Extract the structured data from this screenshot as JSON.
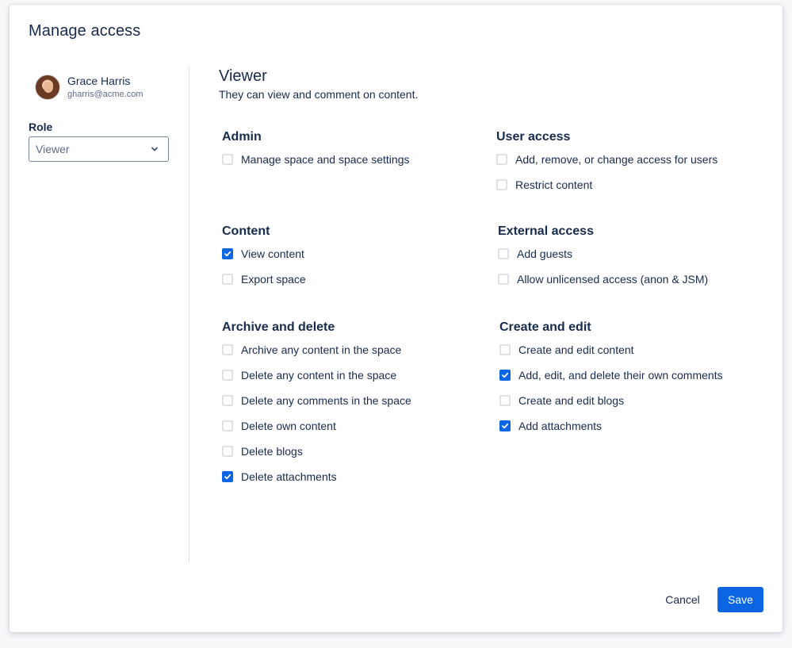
{
  "dialog": {
    "title": "Manage access"
  },
  "user": {
    "name": "Grace Harris",
    "email": "gharris@acme.com",
    "avatar_icon": "user-avatar-photo"
  },
  "role": {
    "label": "Role",
    "selected": "Viewer",
    "dropdown_icon": "chevron-down-icon"
  },
  "role_info": {
    "heading": "Viewer",
    "description": "They can view and comment on content."
  },
  "groups": {
    "admin": {
      "title": "Admin",
      "items": [
        {
          "label": "Manage space and space settings",
          "checked": false
        }
      ]
    },
    "user_access": {
      "title": "User access",
      "items": [
        {
          "label": "Add, remove, or change access for users",
          "checked": false
        },
        {
          "label": "Restrict content",
          "checked": false
        }
      ]
    },
    "content": {
      "title": "Content",
      "items": [
        {
          "label": "View content",
          "checked": true
        },
        {
          "label": "Export space",
          "checked": false
        }
      ]
    },
    "external_access": {
      "title": "External access",
      "items": [
        {
          "label": "Add guests",
          "checked": false
        },
        {
          "label": "Allow unlicensed access (anon & JSM)",
          "checked": false
        }
      ]
    },
    "archive_delete": {
      "title": "Archive and delete",
      "items": [
        {
          "label": "Archive any content in the space",
          "checked": false
        },
        {
          "label": "Delete any content in the space",
          "checked": false
        },
        {
          "label": "Delete any comments in the space",
          "checked": false
        },
        {
          "label": "Delete own content",
          "checked": false
        },
        {
          "label": "Delete blogs",
          "checked": false
        },
        {
          "label": "Delete attachments",
          "checked": true
        }
      ]
    },
    "create_edit": {
      "title": "Create and edit",
      "items": [
        {
          "label": "Create and edit content",
          "checked": false
        },
        {
          "label": "Add, edit, and delete their own comments",
          "checked": true
        },
        {
          "label": "Create and edit blogs",
          "checked": false
        },
        {
          "label": "Add attachments",
          "checked": true
        }
      ]
    }
  },
  "footer": {
    "cancel_label": "Cancel",
    "save_label": "Save"
  },
  "colors": {
    "primary": "#0c66e4",
    "text": "#172b4d",
    "subtle_text": "#5e6c84",
    "checkbox_border": "#dfe1e6"
  }
}
